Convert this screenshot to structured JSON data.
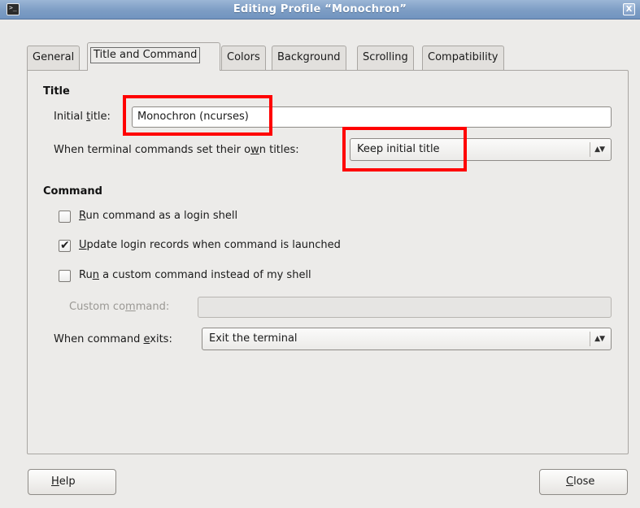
{
  "window": {
    "title": "Editing Profile “Monochron”",
    "app_icon_glyph": ">_",
    "close_glyph": "X"
  },
  "tabs": [
    {
      "label": "General",
      "active": false
    },
    {
      "label": "Title and Command",
      "active": true
    },
    {
      "label": "Colors",
      "active": false
    },
    {
      "label": "Background",
      "active": false
    },
    {
      "label": "Scrolling",
      "active": false
    },
    {
      "label": "Compatibility",
      "active": false
    }
  ],
  "title_section": {
    "heading": "Title",
    "initial_title_label_pre": "Initial ",
    "initial_title_label_mn": "t",
    "initial_title_label_post": "itle:",
    "initial_title_value": "Monochron (ncurses)",
    "when_sets_label_pre": "When terminal commands set their o",
    "when_sets_label_mn": "w",
    "when_sets_label_post": "n titles:",
    "when_sets_value": "Keep initial title"
  },
  "command_section": {
    "heading": "Command",
    "login_shell": {
      "pre": "",
      "mn": "R",
      "post": "un command as a login shell",
      "checked": false
    },
    "update_records": {
      "pre": "",
      "mn": "U",
      "post": "pdate login records when command is launched",
      "checked": true
    },
    "custom_command_check": {
      "pre": "Ru",
      "mn": "n",
      "post": " a custom command instead of my shell",
      "checked": false
    },
    "custom_command_label_pre": "Custom co",
    "custom_command_label_mn": "m",
    "custom_command_label_post": "mand:",
    "custom_command_value": "",
    "exits_label_pre": "When command ",
    "exits_label_mn": "e",
    "exits_label_post": "xits:",
    "exits_value": "Exit the terminal"
  },
  "buttons": {
    "help_mn": "H",
    "help_rest": "elp",
    "close_mn": "C",
    "close_rest": "lose"
  },
  "icons": {
    "combo_arrows": "▲▼",
    "checkmark": "✔"
  },
  "colors": {
    "titlebar": "#7d9dc4",
    "highlight": "#ff0000",
    "dialog_bg": "#ecebe9"
  }
}
